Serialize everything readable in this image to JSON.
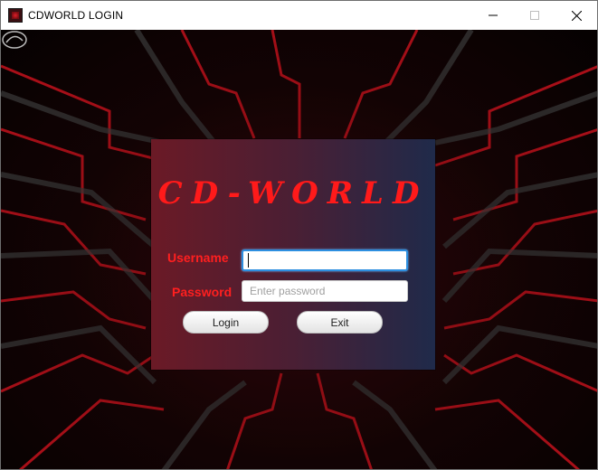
{
  "window": {
    "title": "CDWORLD LOGIN",
    "app_icon": "app-icon",
    "controls": [
      "minimize-icon",
      "maximize-icon",
      "close-icon"
    ]
  },
  "login": {
    "brand": "CD-WORLD",
    "username_label": "Username",
    "username_value": "",
    "password_label": "Password",
    "password_placeholder": "Enter password",
    "login_button": "Login",
    "exit_button": "Exit"
  },
  "colors": {
    "accent_red": "#ff1f1f",
    "panel_left": "#6b1a26",
    "panel_right": "#1f2a4a",
    "focus_blue": "#2d8fe0"
  }
}
